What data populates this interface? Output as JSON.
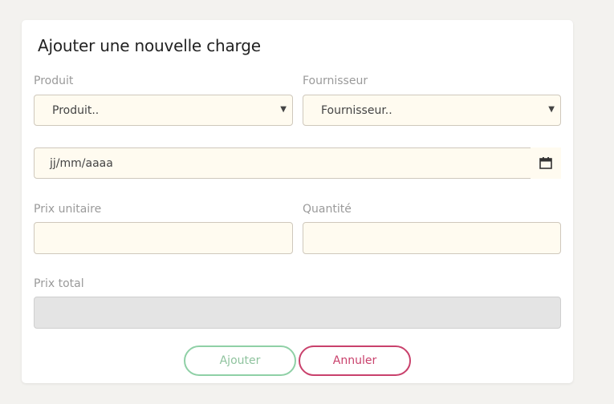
{
  "form": {
    "title": "Ajouter une nouvelle charge",
    "product": {
      "label": "Produit",
      "selected": "Produit.."
    },
    "supplier": {
      "label": "Fournisseur",
      "selected": "Fournisseur.."
    },
    "date": {
      "placeholder": "jj/mm/aaaa",
      "icon": "calendar-icon"
    },
    "unit_price": {
      "label": "Prix unitaire",
      "value": ""
    },
    "quantity": {
      "label": "Quantité",
      "value": ""
    },
    "total_price": {
      "label": "Prix total",
      "value": ""
    },
    "buttons": {
      "add": "Ajouter",
      "cancel": "Annuler"
    }
  },
  "colors": {
    "background": "#f3f2ef",
    "field_bg": "#fffbf0",
    "add_button": "#8fd0a6",
    "cancel_button": "#c9416c",
    "disabled_field": "#e4e4e4"
  }
}
